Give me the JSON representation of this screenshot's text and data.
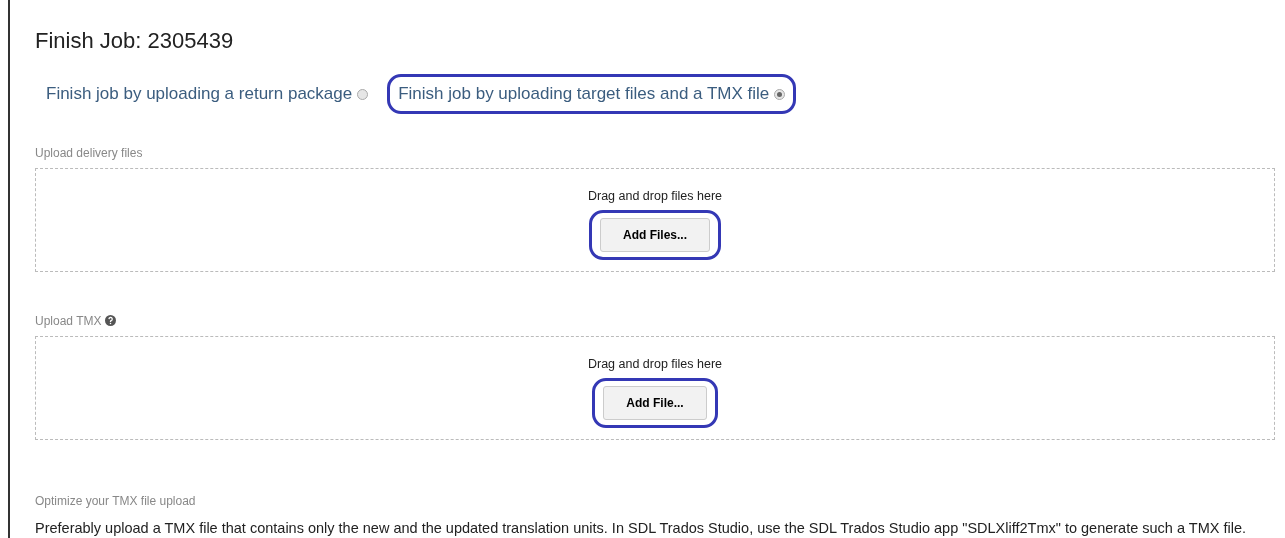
{
  "title": "Finish Job: 2305439",
  "options": [
    {
      "label": "Finish job by uploading a return package",
      "selected": false,
      "highlighted": false
    },
    {
      "label": "Finish job by uploading target files and a TMX file",
      "selected": true,
      "highlighted": true
    }
  ],
  "uploads": [
    {
      "label": "Upload delivery files",
      "help": false,
      "drop_text": "Drag and drop files here",
      "button": "Add Files...",
      "highlighted": true
    },
    {
      "label": "Upload TMX",
      "help": true,
      "drop_text": "Drag and drop files here",
      "button": "Add File...",
      "highlighted": true
    }
  ],
  "note": {
    "label": "Optimize your TMX file upload",
    "text": "Preferably upload a TMX file that contains only the new and the updated translation units. In SDL Trados Studio, use the SDL Trados Studio app \"SDLXliff2Tmx\" to generate such a TMX file."
  }
}
